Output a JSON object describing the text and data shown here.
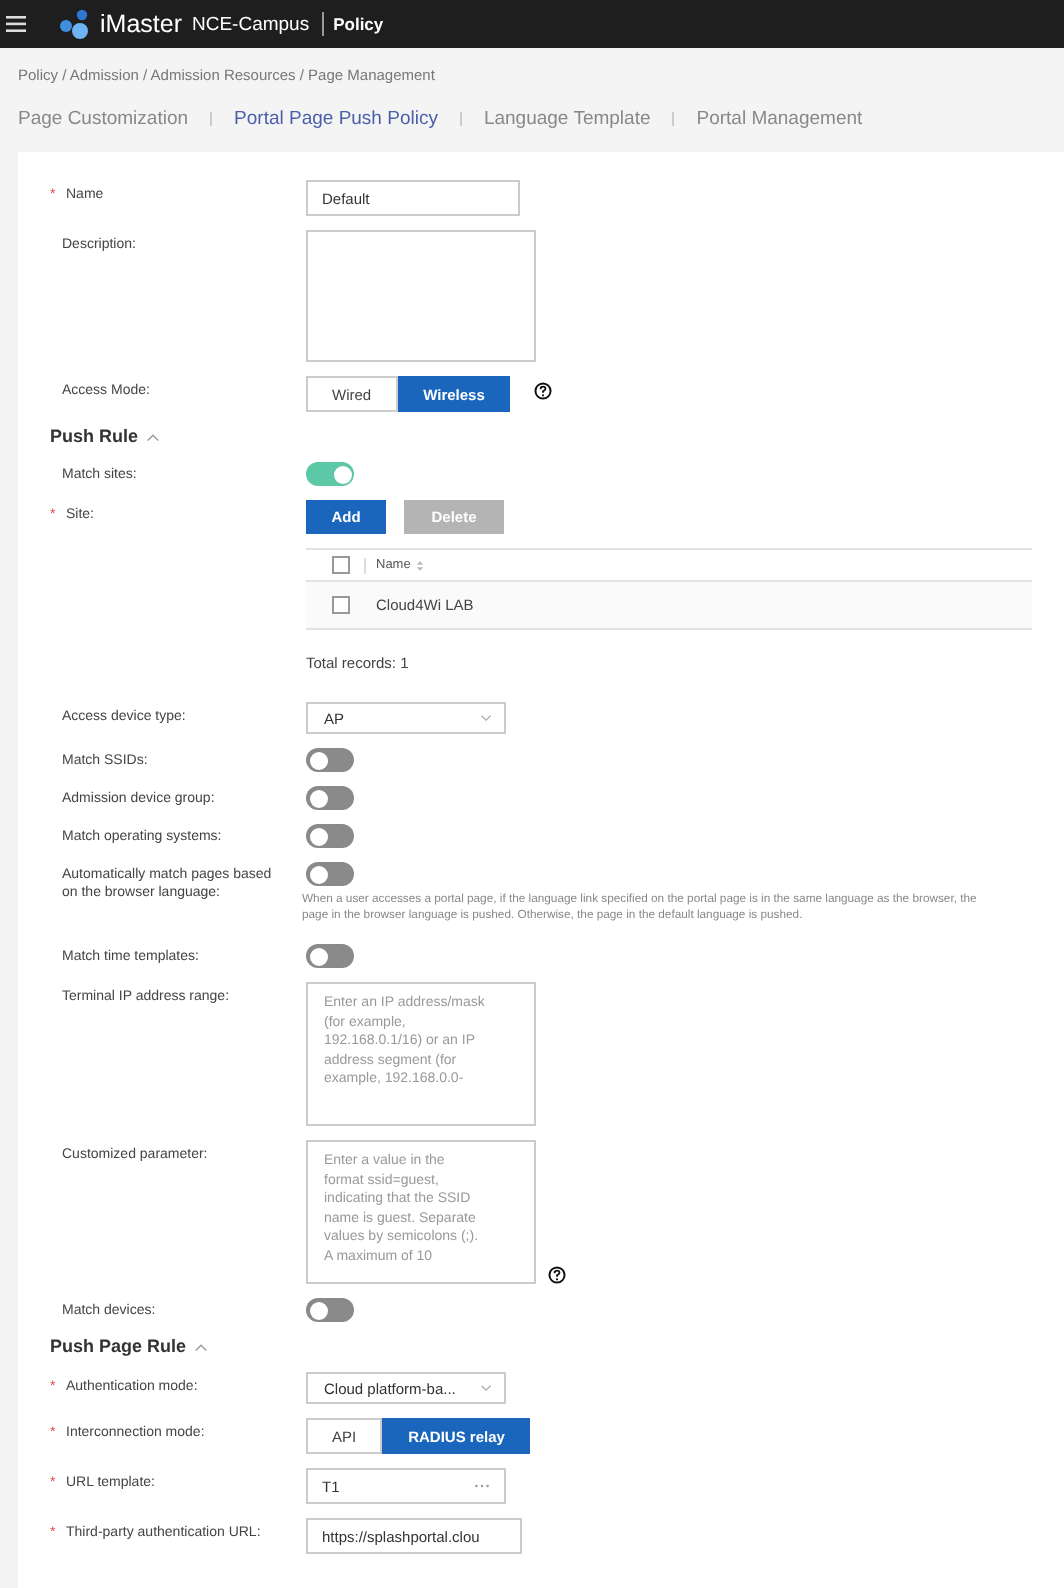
{
  "header": {
    "product": "iMaster",
    "edition": "NCE-Campus",
    "module": "Policy"
  },
  "breadcrumb": "Policy / Admission / Admission Resources / Page Management",
  "tabs": [
    {
      "label": "Page Customization",
      "selected": false
    },
    {
      "label": "Portal Page Push Policy",
      "selected": true
    },
    {
      "label": "Language Template",
      "selected": false
    },
    {
      "label": "Portal Management",
      "selected": false
    }
  ],
  "form": [
    {
      "kind": "input",
      "label": "Name",
      "marker": "*",
      "value": "Default"
    },
    {
      "kind": "textarea",
      "label": "Description:"
    },
    {
      "kind": "segmented",
      "label": "Access Mode:",
      "help": true,
      "options": [
        {
          "label": "Wired",
          "selected": false
        },
        {
          "label": "Wireless",
          "selected": true
        }
      ]
    },
    {
      "kind": "section",
      "label": "Push Rule",
      "expanded": true
    },
    {
      "kind": "toggle",
      "label": "Match sites:",
      "on": true
    },
    {
      "kind": "buttons",
      "label": "Site:",
      "marker": "*",
      "buttons": [
        {
          "label": "Add",
          "disabled": false
        },
        {
          "label": "Delete",
          "disabled": true
        }
      ]
    },
    {
      "kind": "table",
      "all_checked": false,
      "columns": [
        "Name"
      ],
      "rows": [
        {
          "name": "Cloud4Wi LAB",
          "checked": false
        }
      ],
      "total": "Total records: 1"
    },
    {
      "kind": "select",
      "label": "Access device type:",
      "value": "AP"
    },
    {
      "kind": "toggle",
      "label": "Match SSIDs:",
      "on": false
    },
    {
      "kind": "toggle",
      "label": "Admission device group:",
      "on": false
    },
    {
      "kind": "toggle",
      "label": "Match operating systems:",
      "on": false
    },
    {
      "kind": "toggle",
      "label": "Automatically match pages based on the browser language:",
      "on": false,
      "note": "When a user accesses a portal page, if the language link specified on the portal page is in the same language as the browser, the page in the browser language is pushed. Otherwise, the page in the default language is pushed."
    },
    {
      "kind": "toggle",
      "label": "Match time templates:",
      "on": false
    },
    {
      "kind": "textarea",
      "label": "Terminal IP address range:",
      "placeholder": "Enter an IP address/mask (for example, 192.168.0.1/16) or an IP address segment (for example, 192.168.0.0-"
    },
    {
      "kind": "textarea",
      "label": "Customized parameter:",
      "help": true,
      "placeholder": "Enter a value in the format ssid=guest, indicating that the SSID name is guest. Separate values by semicolons (;). A maximum of 10"
    },
    {
      "kind": "toggle",
      "label": "Match devices:",
      "on": false
    },
    {
      "kind": "section",
      "label": "Push Page Rule",
      "expanded": true
    },
    {
      "kind": "select",
      "label": "Authentication mode:",
      "marker": "*",
      "value": "Cloud platform-ba..."
    },
    {
      "kind": "segmented",
      "label": "Interconnection mode:",
      "marker": "*",
      "options": [
        {
          "label": "API",
          "selected": false
        },
        {
          "label": "RADIUS relay",
          "selected": true
        }
      ]
    },
    {
      "kind": "input",
      "label": "URL template:",
      "marker": "*",
      "value": "T1",
      "more": true
    },
    {
      "kind": "input",
      "label": "Third-party authentication URL:",
      "marker": "*",
      "value": "https://splashportal.clou"
    }
  ]
}
